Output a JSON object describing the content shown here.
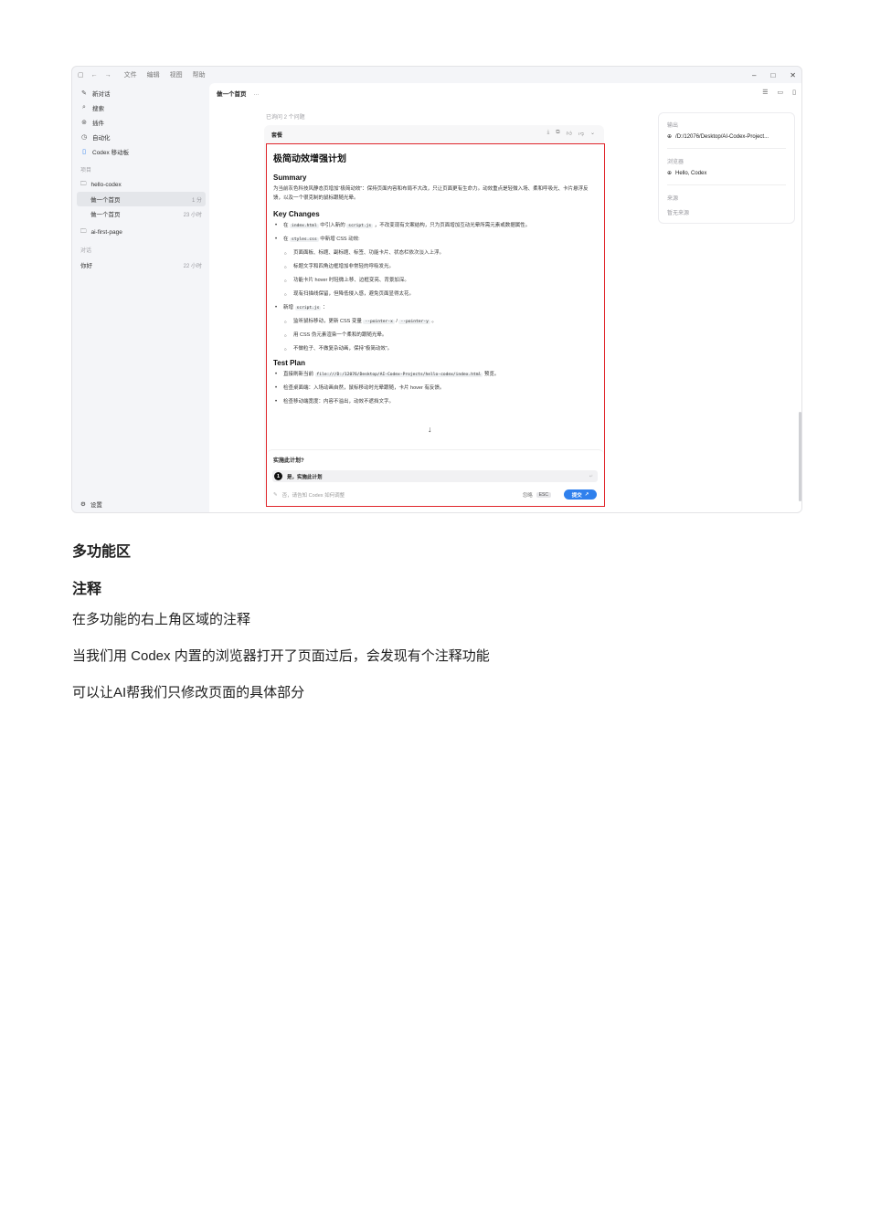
{
  "screenshot": {
    "titlebar": {
      "menu": [
        "文件",
        "编辑",
        "视图",
        "帮助"
      ],
      "win_min": "–",
      "win_max": "□",
      "win_close": "✕"
    },
    "sidebar": {
      "nav": [
        {
          "icon": "new-chat-icon",
          "label": "新对话"
        },
        {
          "icon": "search-icon",
          "label": "搜索"
        },
        {
          "icon": "plugin-icon",
          "label": "插件"
        },
        {
          "icon": "clock-icon",
          "label": "自动化"
        },
        {
          "icon": "mobile-icon",
          "label": "Codex 移动板"
        }
      ],
      "projects_label": "项目",
      "projects": [
        {
          "name": "hello-codex",
          "threads": [
            {
              "title": "做一个首页",
              "time": "1 分"
            },
            {
              "title": "做一个首页",
              "time": "23 小时"
            }
          ]
        },
        {
          "name": "ai-first-page",
          "threads": []
        }
      ],
      "chats_label": "对话",
      "chats": [
        {
          "title": "你好",
          "time": "22 小时"
        }
      ],
      "settings": "设置"
    },
    "main": {
      "title": "做一个首页",
      "more": "···",
      "asked": "已询问 2 个问题",
      "card_title": "套餐",
      "plan": {
        "title": "极简动效增强计划",
        "summary_heading": "Summary",
        "summary_text": "为当前灰色科技风静态页增加“极简动效”：保持页面内容和布局不大改，只让页面更有生命力。动效重点是轻微入场、柔和呼吸光、卡片悬浮反馈，以及一个很克制的鼠标跟随光晕。",
        "key_changes_heading": "Key Changes",
        "kc1_a": "在",
        "kc1_code1": "index.html",
        "kc1_b": "中引入新的",
        "kc1_code2": "script.js",
        "kc1_c": "，不改变现有文案结构，只为页面增加互动光晕所需元素或数据属性。",
        "kc2_a": "在",
        "kc2_code": "styles.css",
        "kc2_b": "中新增 CSS 动效:",
        "kc2_subs": [
          "页面面板、标题、副标题、标签、功能卡片、状态栏依次淡入上浮。",
          "标题文字和四角边框增加非常轻的呼吸发光。",
          "功能卡片 hover 时轻微上移、边框变亮、背景加深。",
          "现有扫描线保留，但降低侵入感，避免页面显得太花。"
        ],
        "kc3_a": "新增",
        "kc3_code": "script.js",
        "kc3_b": "：",
        "kc3_sub1_a": "监听鼠标移动，更新 CSS 变量",
        "kc3_sub1_code1": "--pointer-x",
        "kc3_sub1_sep": "/",
        "kc3_sub1_code2": "--pointer-y",
        "kc3_sub1_b": "。",
        "kc3_sub2": "用 CSS 伪元素渲染一个柔和的跟随光晕。",
        "kc3_sub3": "不做粒子、不做复杂动画，保持“极简动效”。",
        "test_heading": "Test Plan",
        "tp1_a": "直接刷新当前",
        "tp1_code": "file:///D:/12076/Desktop/AI-Codex-Projects/hello-codex/index.html",
        "tp1_b": "预览。",
        "tp2": "检查桌面端：入场动画自然，鼠标移动时光晕跟随，卡片 hover 有反馈。",
        "tp3": "检查移动端宽度：内容不溢出，动效不遮挡文字。"
      },
      "prompt": {
        "question": "实施此计划?",
        "option_num": "1",
        "option_label": "是，实施此计划",
        "reply_placeholder": "否，请告知 Codex 如何调整",
        "ignore": "忽略",
        "esc": "ESC",
        "submit": "提交"
      }
    },
    "right_panel": {
      "output_label": "输出",
      "output_path": "/D:/12076/Desktop/AI-Codex-Project...",
      "browser_label": "浏览器",
      "browser_page": "Hello, Codex",
      "source_label": "来源",
      "source_value": "暂无来源"
    }
  },
  "document": {
    "heading1": "多功能区",
    "heading2": "注释",
    "para1": "在多功能的右上角区域的注释",
    "para2": "当我们用 Codex 内置的浏览器打开了页面过后，会发现有个注释功能",
    "para3": "可以让AI帮我们只修改页面的具体部分"
  }
}
